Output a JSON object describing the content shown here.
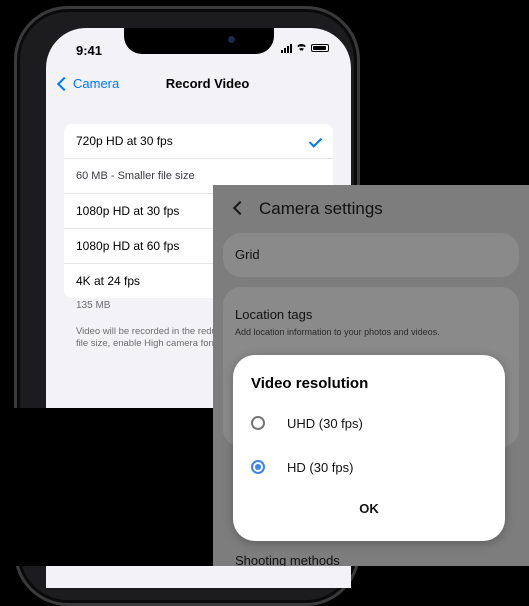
{
  "ios": {
    "status": {
      "time": "9:41"
    },
    "nav": {
      "back_label": "Camera",
      "title": "Record Video"
    },
    "options": [
      {
        "label": "720p HD at 30 fps",
        "selected": true
      },
      {
        "label": "60 MB - Smaller file size",
        "selected": false
      },
      {
        "label": "1080p HD at 30 fps",
        "selected": false
      },
      {
        "label": "1080p HD at 60 fps",
        "selected": false
      },
      {
        "label": "4K at 24 fps",
        "selected": false
      }
    ],
    "footer_size": "135 MB",
    "footer_note": "Video will be recorded in the reduce file size, enable High camera formats.",
    "accent_color": "#007aff"
  },
  "android": {
    "header_title": "Camera settings",
    "grid_label": "Grid",
    "location_title": "Location tags",
    "location_desc": "Add location information to your photos and videos.",
    "shooting_label": "Shooting methods",
    "dialog": {
      "title": "Video resolution",
      "options": [
        {
          "label": "UHD (30 fps)",
          "selected": false
        },
        {
          "label": "HD (30 fps)",
          "selected": true
        }
      ],
      "ok_label": "OK"
    },
    "accent_color": "#3e82f7"
  }
}
